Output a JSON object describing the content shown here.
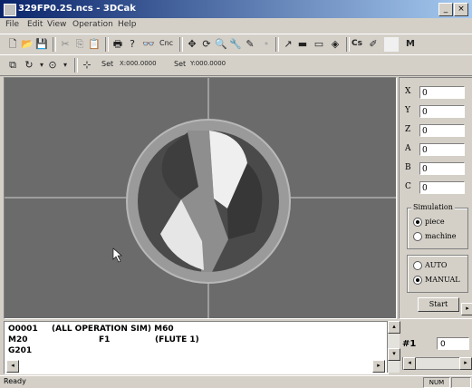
{
  "window": {
    "title": "329FP0.2S.ncs - 3DCak",
    "minimize": "_",
    "close": "×"
  },
  "menu": [
    "File",
    "Edit",
    "View",
    "Operation",
    "Help"
  ],
  "toolbar1": {
    "label_cnc": "Cnc",
    "label_cs": "Cs",
    "label_m": "M"
  },
  "toolbar2": {
    "label_set1": "Set",
    "coord_x": "X:000.0000",
    "label_set2": "Set",
    "coord_y": "Y:000.0000"
  },
  "axes": [
    {
      "name": "X",
      "value": "0"
    },
    {
      "name": "Y",
      "value": "0"
    },
    {
      "name": "Z",
      "value": "0"
    },
    {
      "name": "A",
      "value": "0"
    },
    {
      "name": "B",
      "value": "0"
    },
    {
      "name": "C",
      "value": "0"
    }
  ],
  "simulation": {
    "title": "Simulation",
    "options": [
      "piece",
      "machine"
    ],
    "selected": "piece"
  },
  "mode": {
    "options": [
      "AUTO",
      "MANUAL"
    ],
    "selected": "MANUAL"
  },
  "start_button": "Start",
  "program_lines": [
    {
      "col1": "O0001",
      "col2": "(ALL OPERATION SIM) M60",
      "col3": ""
    },
    {
      "col1": "M20",
      "col2": "F1",
      "col3": "(FLUTE 1)"
    },
    {
      "col1": "G201",
      "col2": "",
      "col3": ""
    }
  ],
  "tool_counter": {
    "label": "#1",
    "value": "0"
  },
  "status": {
    "text": "Ready",
    "num": "NUM"
  }
}
